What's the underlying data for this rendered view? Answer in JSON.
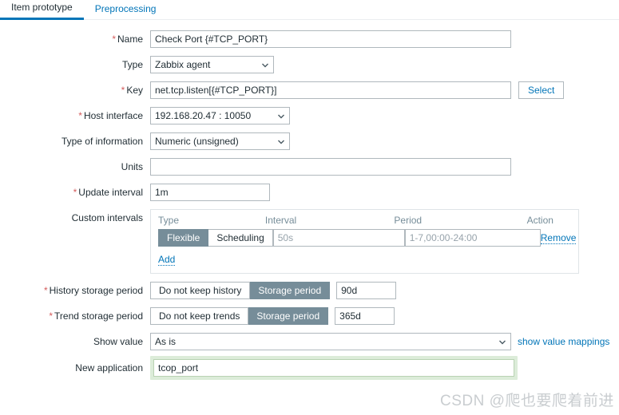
{
  "tabs": [
    {
      "label": "Item prototype",
      "active": true
    },
    {
      "label": "Preprocessing",
      "active": false
    }
  ],
  "form": {
    "name": {
      "label": "Name",
      "required": true,
      "value": "Check Port {#TCP_PORT}"
    },
    "type": {
      "label": "Type",
      "required": false,
      "value": "Zabbix agent",
      "options": [
        "Zabbix agent"
      ]
    },
    "key": {
      "label": "Key",
      "required": true,
      "value": "net.tcp.listen[{#TCP_PORT}]",
      "select_button": "Select"
    },
    "host_interface": {
      "label": "Host interface",
      "required": true,
      "value": "192.168.20.47 : 10050",
      "options": [
        "192.168.20.47 : 10050"
      ]
    },
    "type_of_information": {
      "label": "Type of information",
      "required": false,
      "value": "Numeric (unsigned)",
      "options": [
        "Numeric (unsigned)"
      ]
    },
    "units": {
      "label": "Units",
      "required": false,
      "value": "",
      "placeholder": ""
    },
    "update_interval": {
      "label": "Update interval",
      "required": true,
      "value": "1m"
    },
    "custom_intervals": {
      "label": "Custom intervals",
      "headers": [
        "Type",
        "Interval",
        "Period",
        "Action"
      ],
      "rows": [
        {
          "type_options": [
            "Flexible",
            "Scheduling"
          ],
          "type_selected": "Flexible",
          "interval_value": "",
          "interval_placeholder": "50s",
          "period_value": "",
          "period_placeholder": "1-7,00:00-24:00",
          "action_label": "Remove"
        }
      ],
      "add_label": "Add"
    },
    "history_storage_period": {
      "label": "History storage period",
      "required": true,
      "options": [
        "Do not keep history",
        "Storage period"
      ],
      "selected": "Storage period",
      "value": "90d"
    },
    "trend_storage_period": {
      "label": "Trend storage period",
      "required": true,
      "options": [
        "Do not keep trends",
        "Storage period"
      ],
      "selected": "Storage period",
      "value": "365d"
    },
    "show_value": {
      "label": "Show value",
      "required": false,
      "value": "As is",
      "options": [
        "As is"
      ],
      "link_label": "show value mappings"
    },
    "new_application": {
      "label": "New application",
      "required": false,
      "value": "tcop_port"
    }
  },
  "watermark": "CSDN @爬也要爬着前进",
  "colors": {
    "accent": "#0275b8",
    "toggle_active": "#768d99",
    "required_star": "#d45c5c",
    "focus_glow": "#dcecd9"
  }
}
